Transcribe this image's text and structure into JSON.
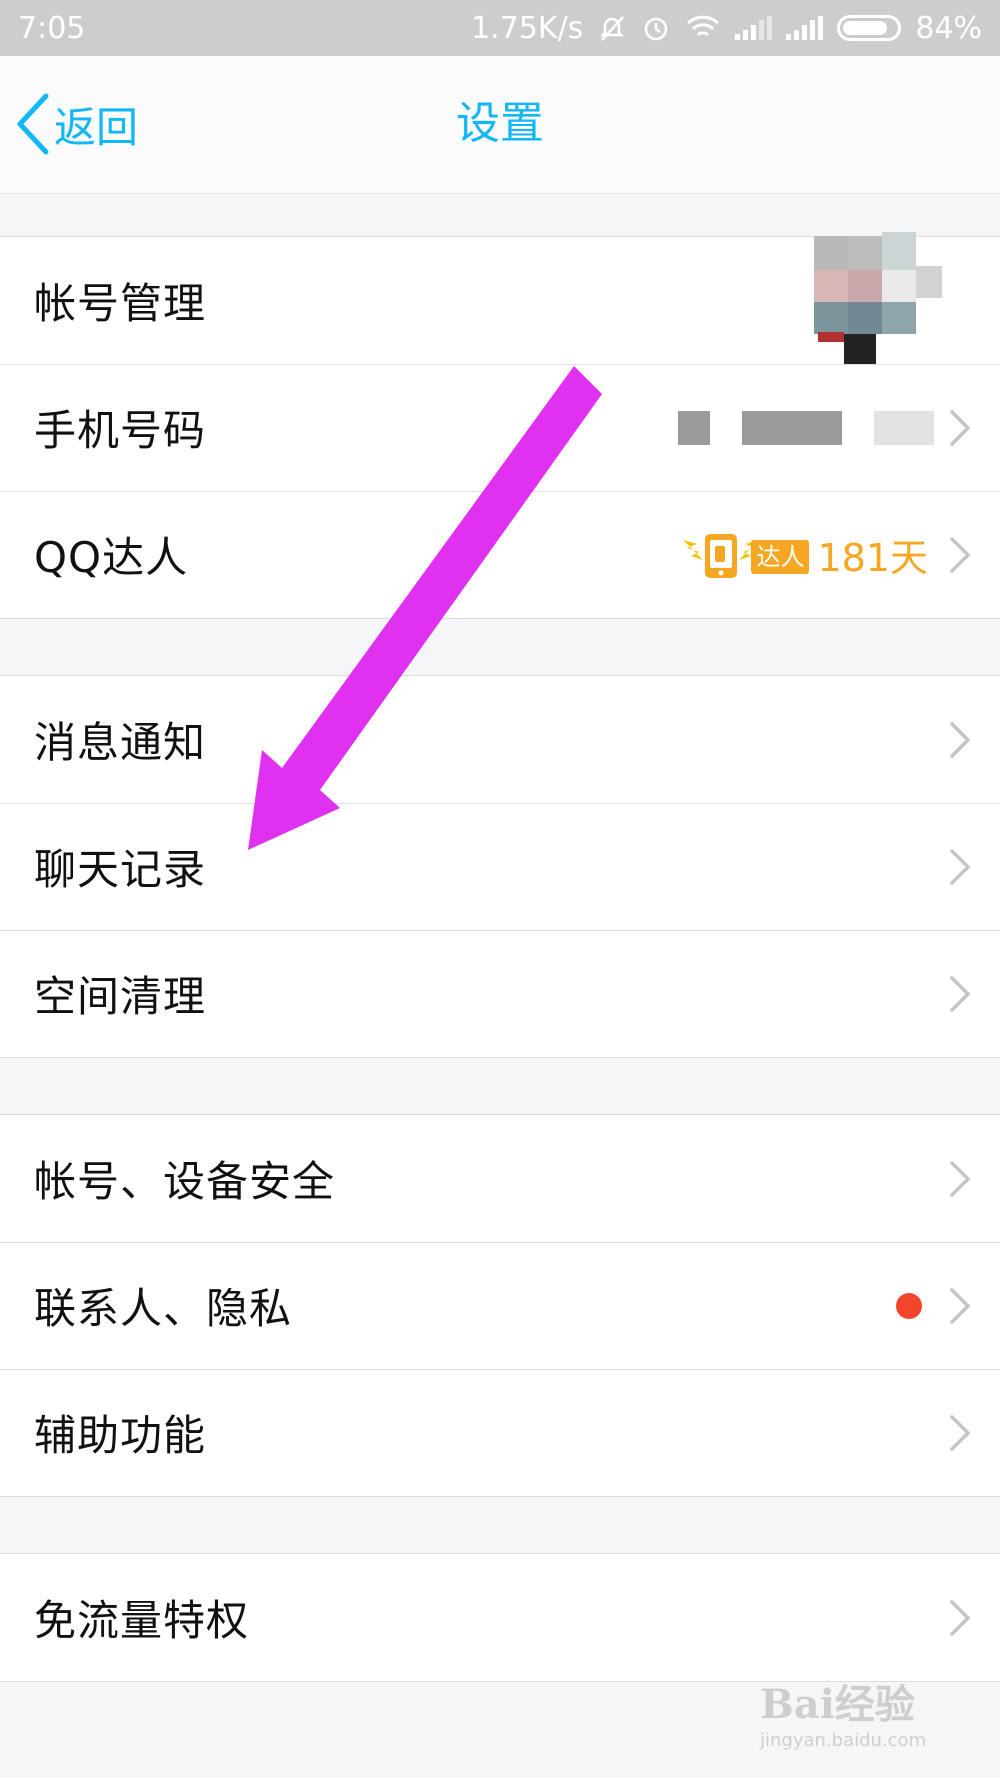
{
  "status_bar": {
    "time": "7:05",
    "speed": "1.75K/s",
    "battery": "84%",
    "battery_level": 0.84
  },
  "nav": {
    "back_label": "返回",
    "title": "设置"
  },
  "groups": [
    {
      "items": [
        {
          "label": "帐号管理"
        },
        {
          "label": "手机号码"
        },
        {
          "label": "QQ达人",
          "badge": "达人",
          "days": "181天"
        }
      ]
    },
    {
      "items": [
        {
          "label": "消息通知"
        },
        {
          "label": "聊天记录"
        },
        {
          "label": "空间清理"
        }
      ]
    },
    {
      "items": [
        {
          "label": "帐号、设备安全"
        },
        {
          "label": "联系人、隐私"
        },
        {
          "label": "辅助功能"
        }
      ]
    },
    {
      "items": [
        {
          "label": "免流量特权"
        }
      ]
    }
  ],
  "colors": {
    "accent": "#12b7f5",
    "annotation_arrow": "#e030f0",
    "badge": "#f5a623",
    "red_dot": "#f2462a"
  },
  "watermark": {
    "logo": "Bai经验",
    "url": "jingyan.baidu.com"
  }
}
